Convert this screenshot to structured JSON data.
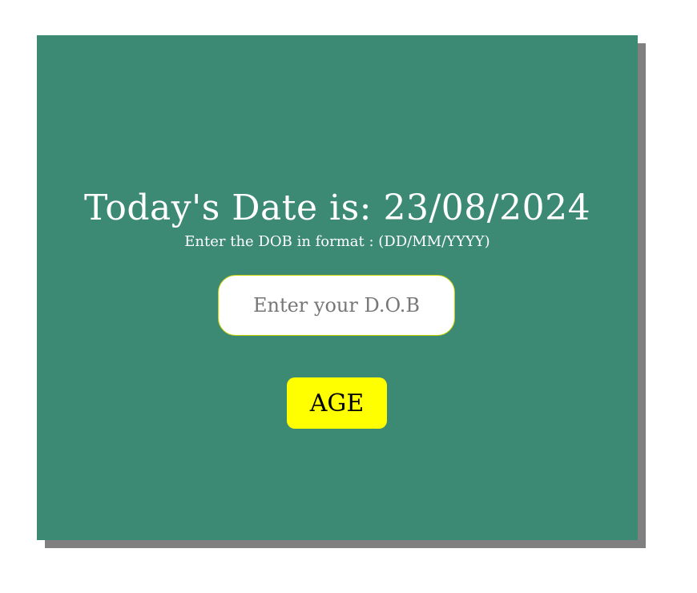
{
  "colors": {
    "card_background": "#3d8a74",
    "card_shadow": "#808080",
    "button_background": "#ffff00",
    "input_border": "#c8d200",
    "text_light": "#ffffff"
  },
  "header": {
    "title": "Today's Date is: 23/08/2024"
  },
  "form": {
    "hint": "Enter the DOB in format : (DD/MM/YYYY)",
    "dob_placeholder": "Enter your D.O.B",
    "dob_value": "",
    "age_button_label": "AGE"
  }
}
